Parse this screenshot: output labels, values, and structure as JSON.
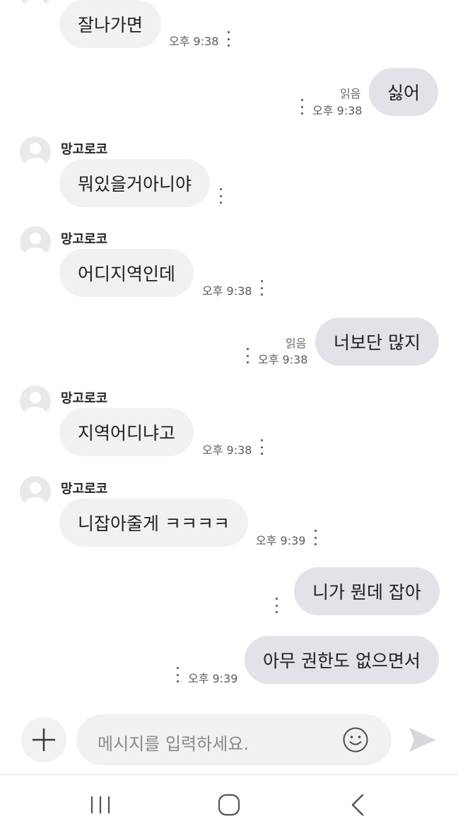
{
  "messages": [
    {
      "text": "잘나가면",
      "time": "오후 9:38"
    },
    {
      "text": "싫어",
      "read": "읽음",
      "time": "오후 9:38"
    },
    {
      "sender": "망고로코",
      "text": "뭐있을거아니야"
    },
    {
      "sender": "망고로코",
      "text": "어디지역인데",
      "time": "오후 9:38"
    },
    {
      "text": "너보단 많지",
      "read": "읽음",
      "time": "오후 9:38"
    },
    {
      "sender": "망고로코",
      "text": "지역어디냐고",
      "time": "오후 9:38"
    },
    {
      "sender": "망고로코",
      "text": "니잡아줄게 ㅋㅋㅋㅋ",
      "time": "오후 9:39"
    },
    {
      "text": "니가 뭔데 잡아"
    },
    {
      "text": "아무 권한도 없으면서",
      "time": "오후 9:39"
    }
  ],
  "composer": {
    "placeholder": "메시지를 입력하세요."
  },
  "icons": {
    "attach": "plus-icon",
    "emoji": "smiley-icon",
    "send": "send-arrow-icon",
    "more": "vertical-dots-icon",
    "nav_recents": "recent-apps-icon",
    "nav_home": "home-icon",
    "nav_back": "back-icon"
  },
  "colors": {
    "incoming_bubble": "#f1f1f4",
    "outgoing_bubble": "#e2e3e8",
    "avatar_bg": "#e9e9ec"
  }
}
